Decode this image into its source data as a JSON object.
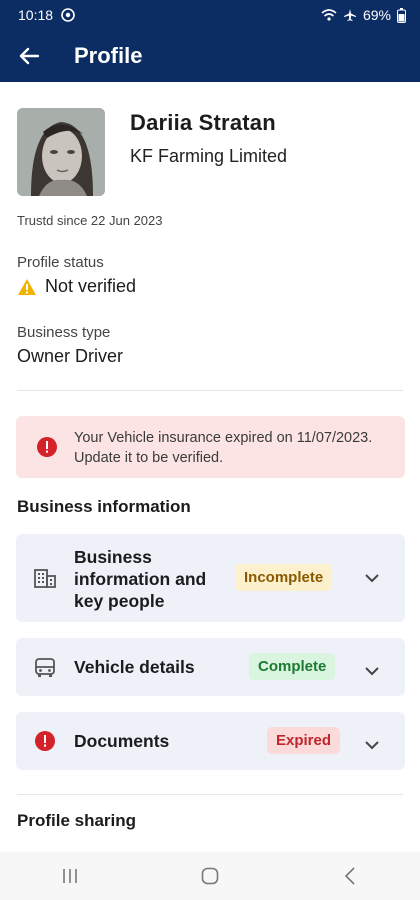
{
  "status_bar": {
    "time": "10:18",
    "battery": "69%"
  },
  "app_bar": {
    "title": "Profile"
  },
  "profile": {
    "name": "Dariia Stratan",
    "company": "KF Farming Limited",
    "since": "Trustd since 22 Jun 2023",
    "status_label": "Profile status",
    "status_value": "Not verified",
    "business_type_label": "Business type",
    "business_type_value": "Owner Driver"
  },
  "alert": {
    "text": "Your Vehicle insurance expired on 11/07/2023. Update it to be verified."
  },
  "business_section": {
    "title": "Business information",
    "items": [
      {
        "label": "Business information and key people",
        "status": "Incomplete",
        "icon": "building-icon"
      },
      {
        "label": "Vehicle details",
        "status": "Complete",
        "icon": "bus-icon"
      },
      {
        "label": "Documents",
        "status": "Expired",
        "icon": "error-icon"
      }
    ]
  },
  "sharing_section": {
    "title": "Profile sharing"
  },
  "colors": {
    "primary": "#0c2d63",
    "alert_bg": "#fde4e4",
    "error": "#d3222a",
    "warning": "#f2b300"
  }
}
